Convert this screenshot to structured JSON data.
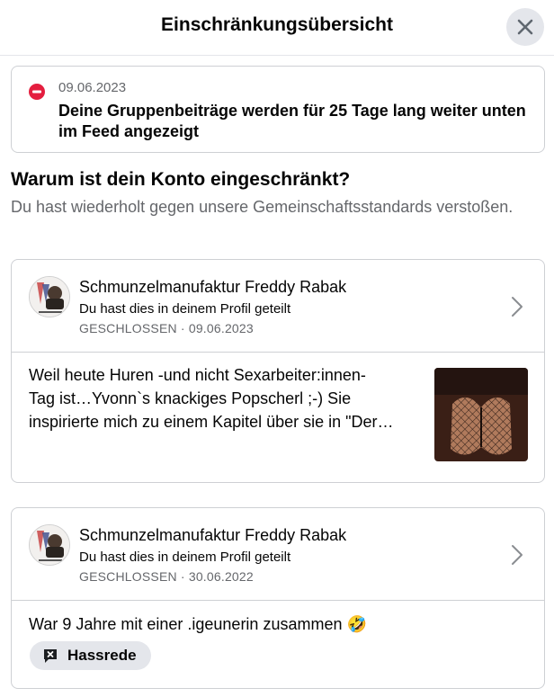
{
  "header": {
    "title": "Einschränkungsübersicht"
  },
  "notice": {
    "date": "09.06.2023",
    "text": "Deine Gruppenbeiträge werden für 25 Tage lang weiter unten im Feed angezeigt"
  },
  "why": {
    "title": "Warum ist dein Konto eingeschränkt?",
    "description": "Du hast wiederholt gegen unsere Gemeinschaftsstandards verstoßen."
  },
  "cards": [
    {
      "name": "Schmunzelmanufaktur Freddy Rabak",
      "subtitle": "Du hast dies in deinem Profil geteilt",
      "meta": "GESCHLOSSEN · 09.06.2023",
      "text_line1": "Weil heute Huren -und nicht Sexarbeiter:innen-",
      "text_line2": "Tag ist…Yvonn`s knackiges Popscherl ;-) Sie",
      "text_line3": "inspirierte mich zu einem Kapitel über sie in \"Der…"
    },
    {
      "name": "Schmunzelmanufaktur Freddy Rabak",
      "subtitle": "Du hast dies in deinem Profil geteilt",
      "meta": "GESCHLOSSEN · 30.06.2022",
      "text": "War 9 Jahre mit einer .igeunerin zusammen 🤣",
      "tag": "Hassrede"
    }
  ],
  "colors": {
    "secondary_text": "#65676b",
    "chip_bg": "#e4e6eb",
    "stop_red": "#e41e3f"
  }
}
